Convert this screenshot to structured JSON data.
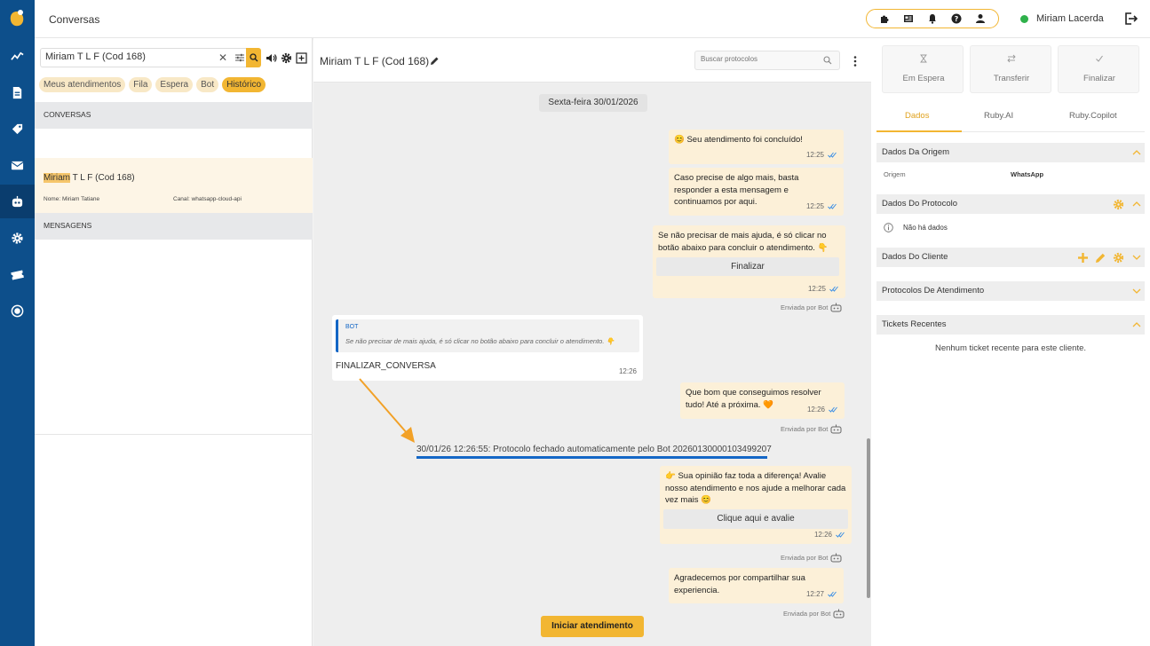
{
  "header": {
    "title": "Conversas",
    "user_name": "Miriam Lacerda",
    "toolbar_icons": [
      "puzzle-icon",
      "newspaper-icon",
      "bell-icon",
      "help-icon",
      "user-icon"
    ],
    "online_color": "#2fb14b"
  },
  "nav": {
    "items": [
      "dashboard-icon",
      "document-icon",
      "tag-icon",
      "mail-icon",
      "bot-icon",
      "settings-icon",
      "ticket-icon",
      "nps-icon"
    ],
    "active": "bot-icon",
    "color": "#0d4f8b"
  },
  "left": {
    "search_value": "Miriam T L F (Cod 168)",
    "filters": [
      "Meus atendimentos",
      "Fila",
      "Espera",
      "Bot",
      "Histórico"
    ],
    "active_filter": "Histórico",
    "section_conversas": "CONVERSAS",
    "section_mensagens": "MENSAGENS",
    "conversation": {
      "name_highlight": "Miriam",
      "name_rest": " T L F (Cod 168)",
      "nome": "Nome: Miriam Tatiane",
      "canal": "Canal: whatsapp-cloud-api"
    }
  },
  "chat": {
    "title": "Miriam T L F (Cod 168)",
    "search_placeholder": "Buscar protocolos",
    "date": "Sexta-feira 30/01/2026",
    "messages": {
      "m1": "😊 Seu atendimento foi concluído!",
      "m1_time": "12:25",
      "m2": "Caso precise de algo mais, basta responder a esta mensagem e continuamos por aqui.",
      "m2_time": "12:25",
      "m3": "Se não precisar de mais ajuda, é só clicar no botão abaixo para concluir o atendimento. 👇",
      "m3_button": "Finalizar",
      "m3_time": "12:25",
      "sent_by": "Enviada por Bot",
      "bot_label": "BOT",
      "bot_quote": "Se não precisar de mais ajuda, é só clicar no botão abaixo para concluir o atendimento. 👇",
      "bot_msg": "FINALIZAR_CONVERSA",
      "bot_time": "12:26",
      "m4": "Que bom que conseguimos resolver tudo! Até a próxima. 🧡",
      "m4_time": "12:26",
      "protocol_note": "30/01/26 12:26:55: Protocolo fechado automaticamente pelo Bot 20260130000103499207",
      "m5": "👉 Sua opinião faz toda a diferença! Avalie nosso atendimento e nos ajude a melhorar cada vez mais 😊",
      "m5_button": "Clique aqui e avalie",
      "m5_time": "12:26",
      "m6": "Agradecemos por compartilhar sua experiencia.",
      "m6_time": "12:27"
    },
    "start_button": "Iniciar atendimento"
  },
  "right": {
    "actions": [
      "Em Espera",
      "Transferir",
      "Finalizar"
    ],
    "tabs": [
      "Dados",
      "Ruby.AI",
      "Ruby.Copilot"
    ],
    "active_tab": "Dados",
    "sections": {
      "origem": "Dados Da Origem",
      "protocolo": "Dados Do Protocolo",
      "cliente": "Dados Do Cliente",
      "protocolos": "Protocolos De Atendimento",
      "tickets": "Tickets Recentes"
    },
    "origem_key": "Origem",
    "origem_value": "WhatsApp",
    "no_data": "Não há dados",
    "no_tickets": "Nenhum ticket recente para este cliente.",
    "accent": "#f2b632"
  }
}
